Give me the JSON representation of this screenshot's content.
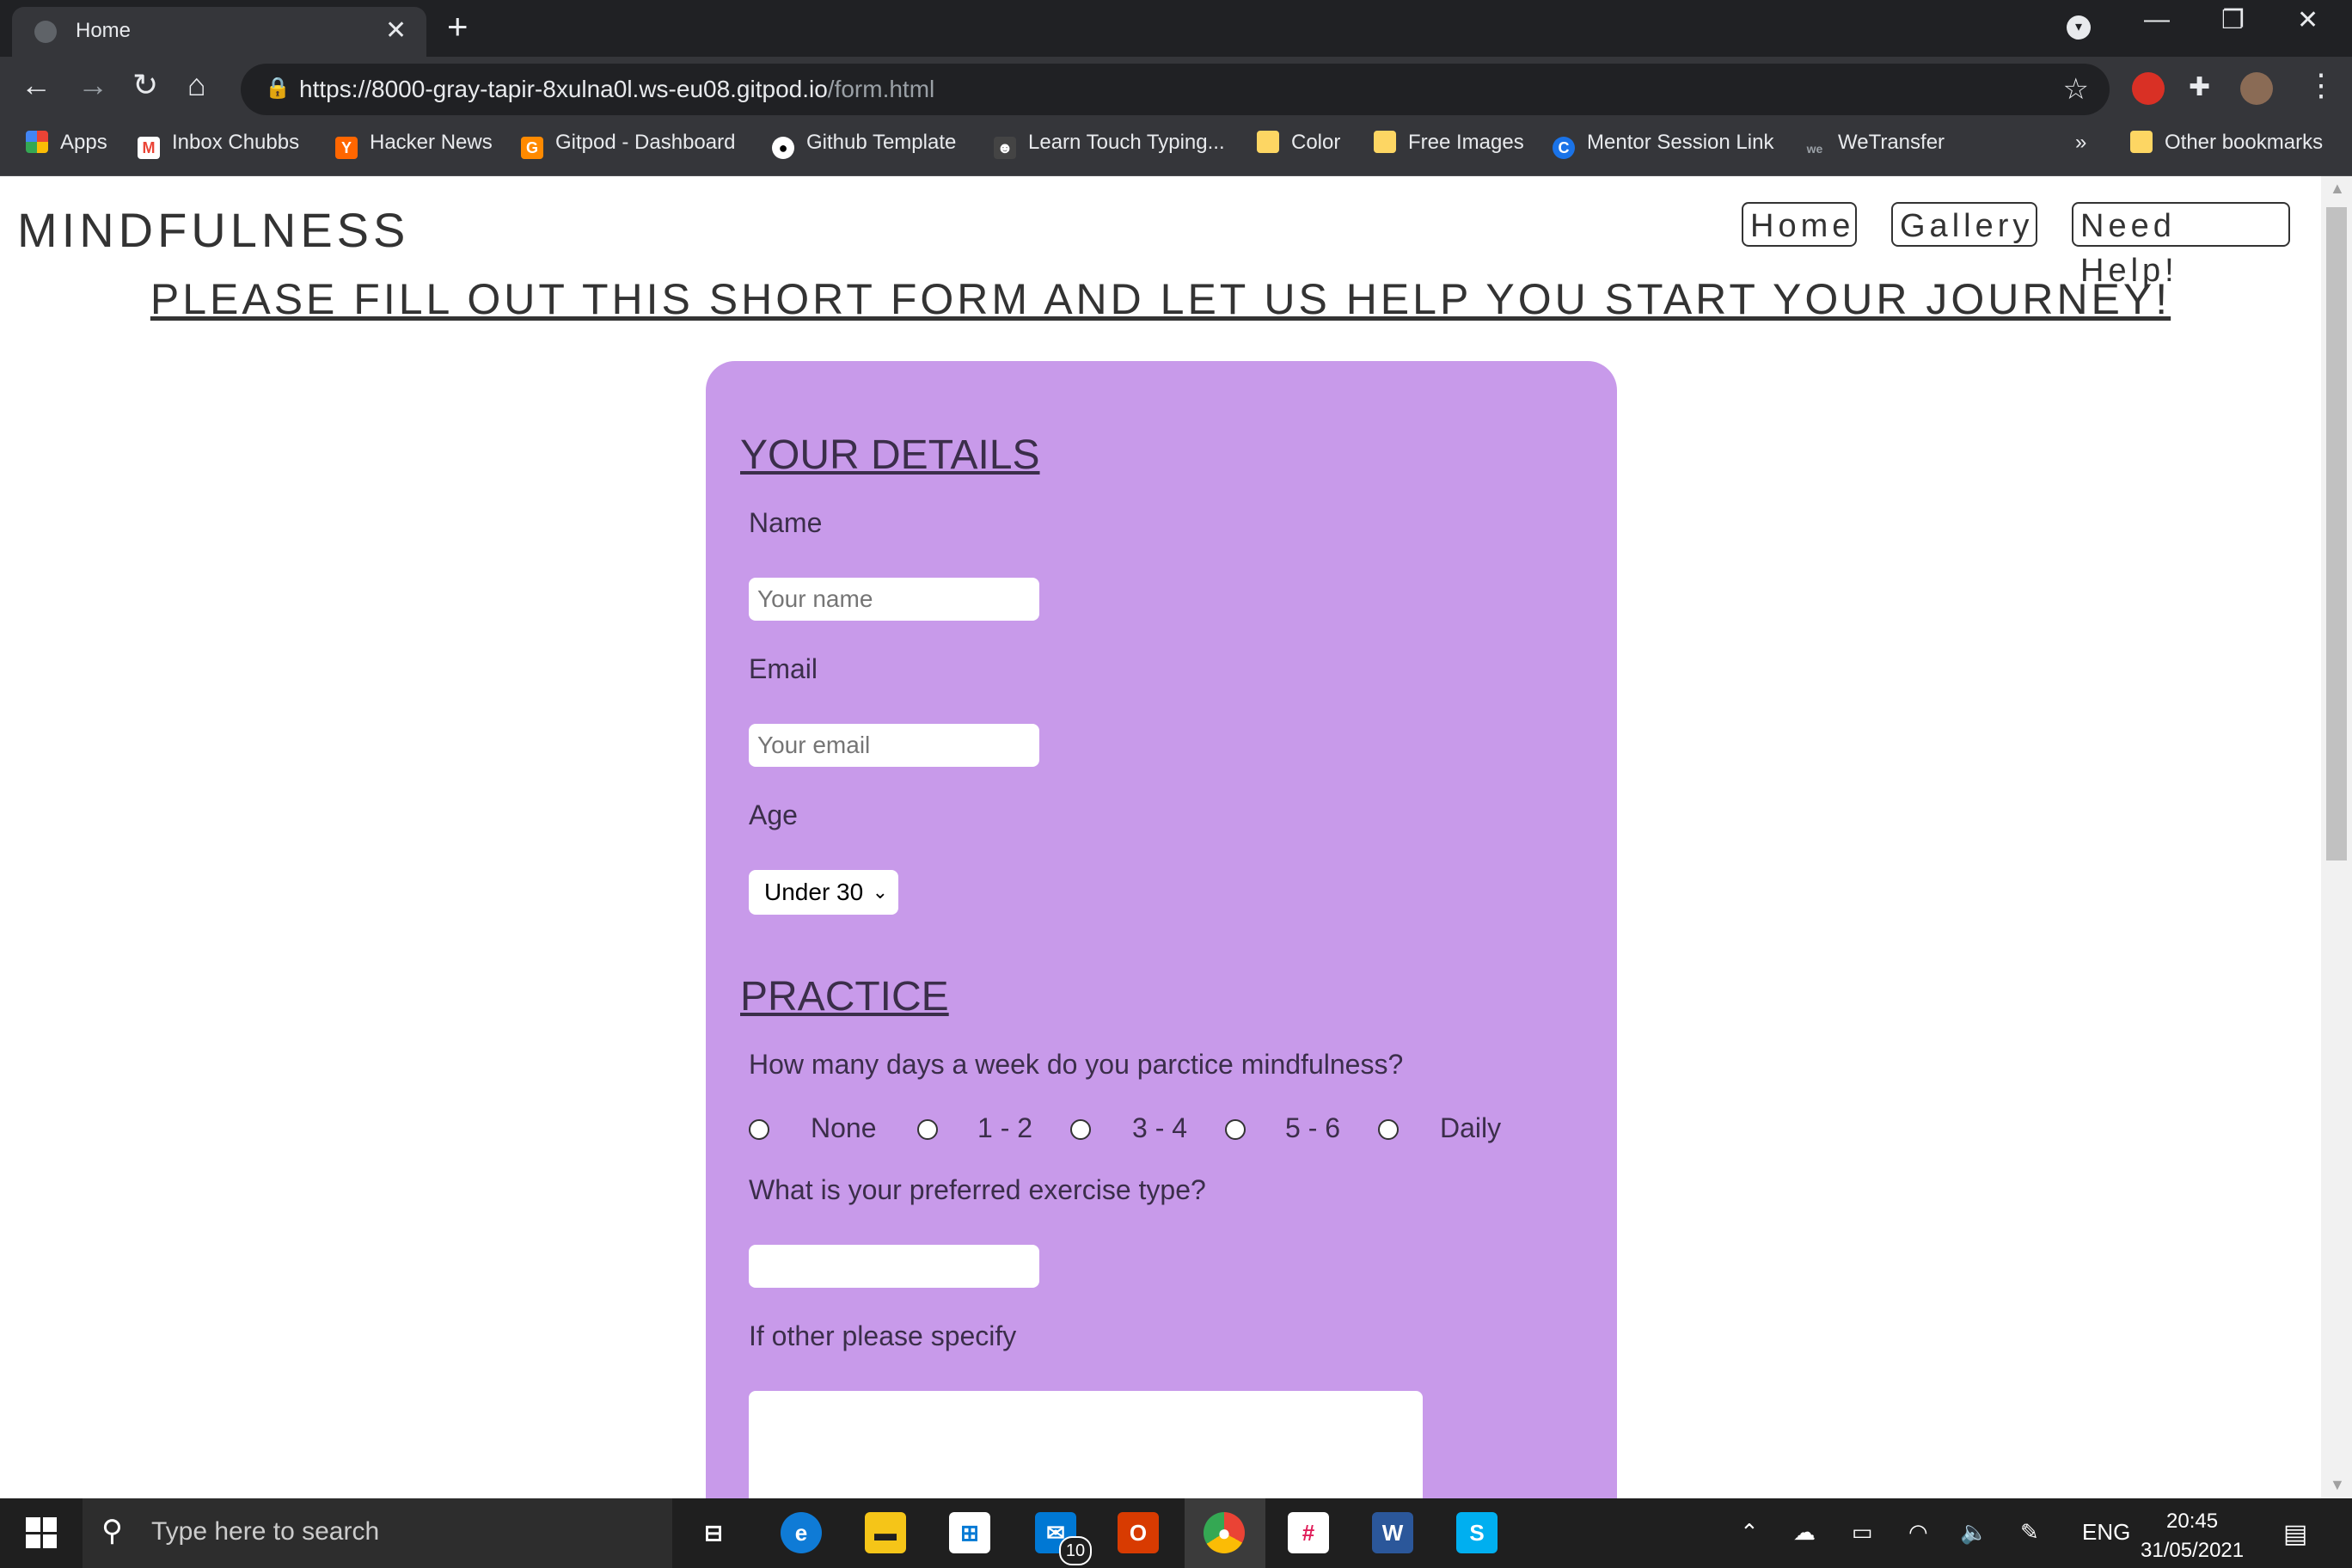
{
  "browser": {
    "tab_title": "Home",
    "url_host": "https://8000-gray-tapir-8xulna0l.ws-eu08.gitpod.io",
    "url_path": "/form.html",
    "bookmarks": [
      {
        "label": "Apps",
        "icon": "apps-grid-icon"
      },
      {
        "label": "Inbox Chubbs",
        "icon": "gmail-icon"
      },
      {
        "label": "Hacker News",
        "icon": "hacker-news-icon"
      },
      {
        "label": "Gitpod - Dashboard",
        "icon": "gitpod-icon"
      },
      {
        "label": "Github Template",
        "icon": "github-icon"
      },
      {
        "label": "Learn Touch Typing...",
        "icon": "typing-icon"
      },
      {
        "label": "Color",
        "icon": "folder-icon"
      },
      {
        "label": "Free Images",
        "icon": "folder-icon"
      },
      {
        "label": "Mentor Session Link",
        "icon": "link-icon"
      },
      {
        "label": "WeTransfer",
        "icon": "wetransfer-icon"
      }
    ],
    "bookmarks_overflow": "»",
    "other_bookmarks": "Other bookmarks"
  },
  "site": {
    "brand": "MINDFULNESS",
    "nav": [
      "Home",
      "Gallery",
      "Need Help!"
    ],
    "intro": "PLEASE FILL OUT THIS SHORT FORM AND LET US HELP YOU START YOUR JOURNEY!"
  },
  "form": {
    "details_title": "YOUR DETAILS",
    "name_label": "Name",
    "name_placeholder": "Your name",
    "email_label": "Email",
    "email_placeholder": "Your email",
    "age_label": "Age",
    "age_selected": "Under 30",
    "practice_title": "PRACTICE",
    "days_question": "How many days a week do you parctice mindfulness?",
    "day_options": [
      "None",
      "1 - 2",
      "3 - 4",
      "5 - 6",
      "Daily"
    ],
    "exercise_question": "What is your preferred exercise type?",
    "other_label": "If other please specify"
  },
  "taskbar": {
    "search_placeholder": "Type here to search",
    "mail_badge": "10",
    "language": "ENG",
    "time": "20:45",
    "date": "31/05/2021"
  },
  "colors": {
    "form_background": "#c89aea",
    "chrome_dark": "#202124",
    "chrome_toolbar": "#35363a"
  }
}
